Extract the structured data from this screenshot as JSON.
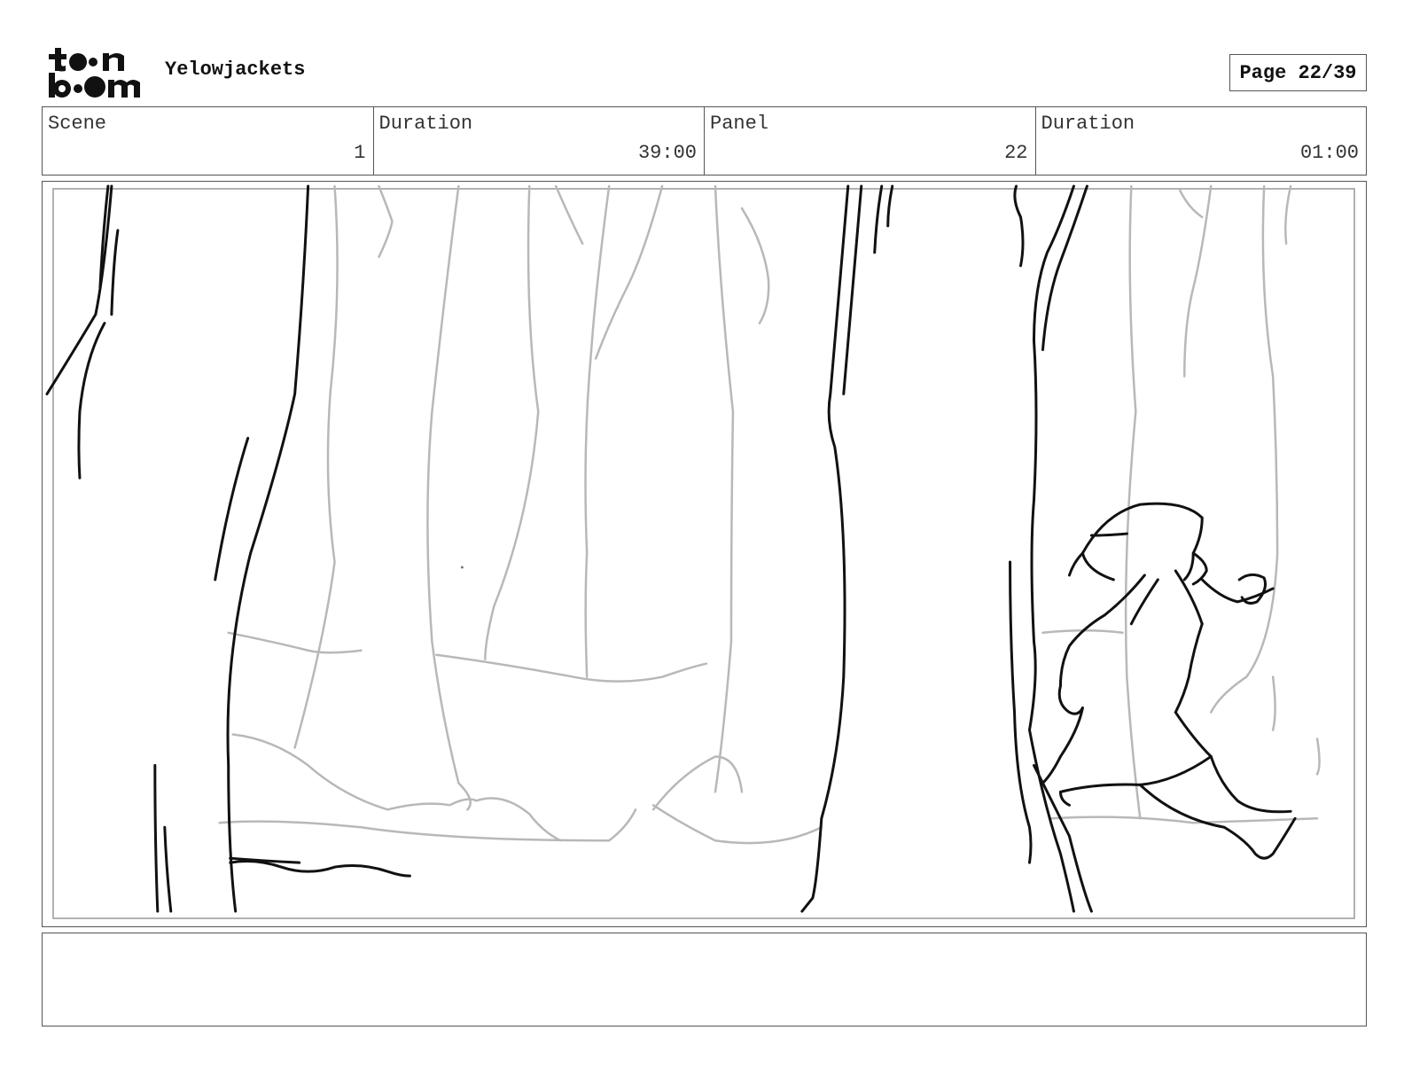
{
  "header": {
    "project_title": "Yelowjackets",
    "page_indicator": "Page 22/39"
  },
  "info": {
    "scene_label": "Scene",
    "scene_value": "1",
    "scene_duration_label": "Duration",
    "scene_duration_value": "39:00",
    "panel_label": "Panel",
    "panel_value": "22",
    "panel_duration_label": "Duration",
    "panel_duration_value": "01:00"
  },
  "caption": {
    "text": ""
  },
  "colors": {
    "ink": "#111111",
    "sketch_gray": "#b8b8b8",
    "border": "#555555"
  }
}
